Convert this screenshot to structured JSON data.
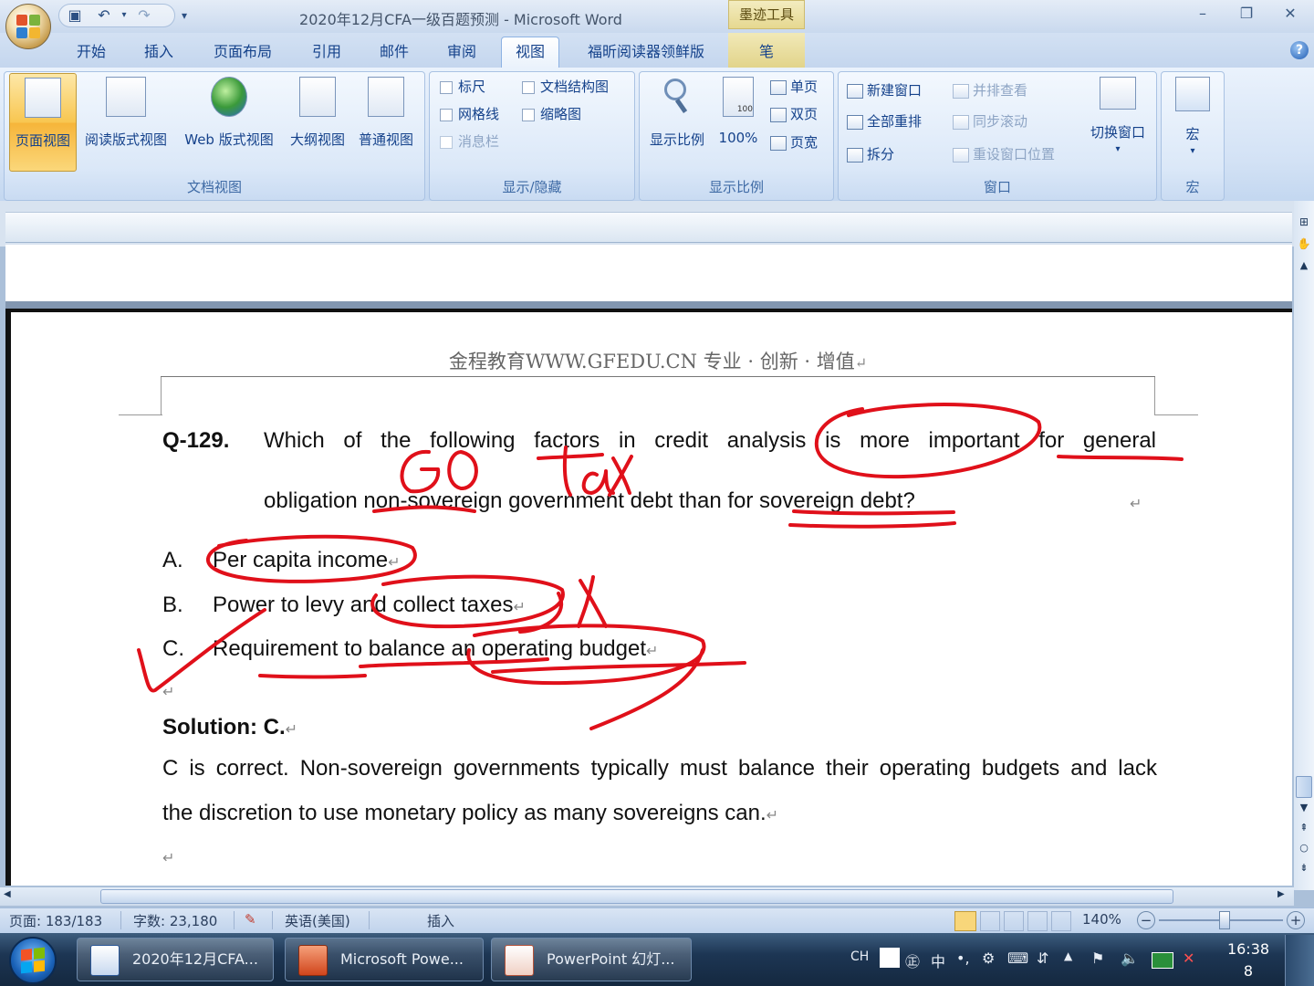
{
  "window": {
    "title": "2020年12月CFA一级百题预测 - Microsoft Word",
    "contextual_tab_header": "墨迹工具"
  },
  "quick_access": {
    "save": "save-icon",
    "undo": "undo-icon",
    "redo": "redo-icon",
    "customize": "customize-icon"
  },
  "tabs": [
    "开始",
    "插入",
    "页面布局",
    "引用",
    "邮件",
    "审阅",
    "视图",
    "福昕阅读器领鲜版",
    "笔"
  ],
  "active_tab": "视图",
  "ribbon": {
    "doc_views": {
      "label": "文档视图",
      "buttons": [
        "页面视图",
        "阅读版式视图",
        "Web 版式视图",
        "大纲视图",
        "普通视图"
      ]
    },
    "show_hide": {
      "label": "显示/隐藏",
      "items": [
        "标尺",
        "文档结构图",
        "网格线",
        "缩略图",
        "消息栏"
      ]
    },
    "zoom": {
      "label": "显示比例",
      "zoom_button": "显示比例",
      "hundred_button": "100%",
      "hundred_icon_text": "100",
      "one_page": "单页",
      "two_pages": "双页",
      "page_width": "页宽"
    },
    "window": {
      "label": "窗口",
      "new_window": "新建窗口",
      "arrange_all": "全部重排",
      "split": "拆分",
      "side_by_side": "并排查看",
      "sync_scroll": "同步滚动",
      "reset_position": "重设窗口位置",
      "switch_windows": "切换窗口"
    },
    "macros": {
      "label": "宏",
      "button": "宏"
    }
  },
  "document": {
    "header": "金程教育WWW.GFEDU.CN 专业 · 创新 · 增值",
    "question_number": "Q-129.",
    "question_line1": "Which of the following factors in credit analysis is more important for general",
    "question_line2": "obligation non-sovereign government debt than for sovereign debt?",
    "options": [
      {
        "letter": "A.",
        "text": "Per capita income"
      },
      {
        "letter": "B.",
        "text": "Power to levy and collect taxes"
      },
      {
        "letter": "C.",
        "text": "Requirement to balance an operating budget"
      }
    ],
    "solution_label": "Solution: C.",
    "solution_line1": "C is correct. Non-sovereign governments typically must balance their operating budgets and lack",
    "solution_line2": "the discretion to use monetary policy as many sovereigns can.",
    "paragraph_mark": "↵",
    "ink_annotations": [
      "GO",
      "tax",
      "X"
    ]
  },
  "status": {
    "page": "页面: 183/183",
    "words": "字数: 23,180",
    "language": "英语(美国)",
    "mode": "插入",
    "zoom": "140%"
  },
  "taskbar": {
    "items": [
      "2020年12月CFA...",
      "Microsoft Powe...",
      "PowerPoint 幻灯..."
    ],
    "tray_lang": "CH",
    "tray_ime": "中",
    "tray_punct": "•,",
    "time": "16:38",
    "time_sub": "8"
  },
  "colors": {
    "ink": "#e0101a",
    "ribbon_active": "#f8c650",
    "taskbar": "#1d3654"
  }
}
